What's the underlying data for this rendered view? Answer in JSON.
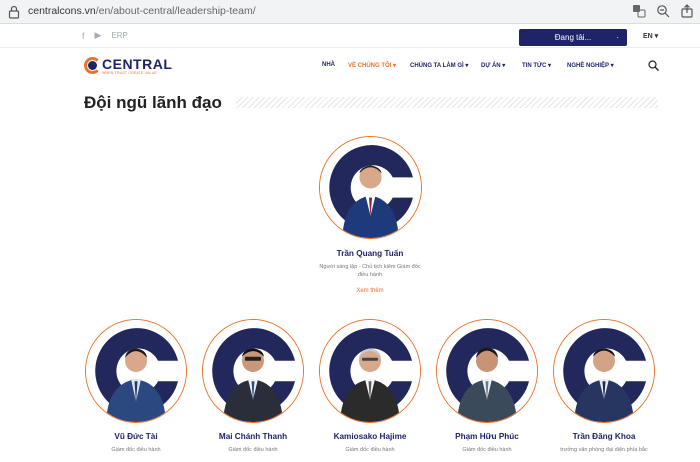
{
  "browser": {
    "url_host": "centralcons.vn",
    "url_path": "/en/about-central/leadership-team/"
  },
  "topbar": {
    "social": [
      "f",
      "▶",
      "ERP"
    ],
    "loading_label": "Đang tải...",
    "language": "EN ▾"
  },
  "brand": {
    "logo_text": "CENTRAL",
    "logo_sub": "WHEN TRUST CREATE VALUE"
  },
  "nav": {
    "items": [
      {
        "label": "NHÀ"
      },
      {
        "label": "VỀ CHÚNG TÔI ▾"
      },
      {
        "label": "CHÚNG TA LÀM GÌ ▾"
      },
      {
        "label": "DỰ ÁN ▾"
      },
      {
        "label": "TIN TỨC ▾"
      },
      {
        "label": "NGHỀ NGHIỆP ▾"
      }
    ]
  },
  "page": {
    "title": "Đội ngũ lãnh đạo"
  },
  "leaders": [
    {
      "name": "Trần Quang Tuấn",
      "role": "Người sáng lập - Chủ tịch kiêm Giám đốc điều hành",
      "more": "Xem thêm"
    },
    {
      "name": "Vũ Đức Tài",
      "role": "Giám đốc điều hành"
    },
    {
      "name": "Mai Chánh Thanh",
      "role": "Giám đốc điều hành"
    },
    {
      "name": "Kamiosako Hajime",
      "role": "Giám đốc điều hành"
    },
    {
      "name": "Phạm Hữu Phúc",
      "role": "Giám đốc điều hành"
    },
    {
      "name": "Trần Đăng Khoa",
      "role": "trưởng văn phòng đại diện phía bắc"
    }
  ],
  "colors": {
    "navy": "#1e2466",
    "orange": "#e8742a"
  }
}
